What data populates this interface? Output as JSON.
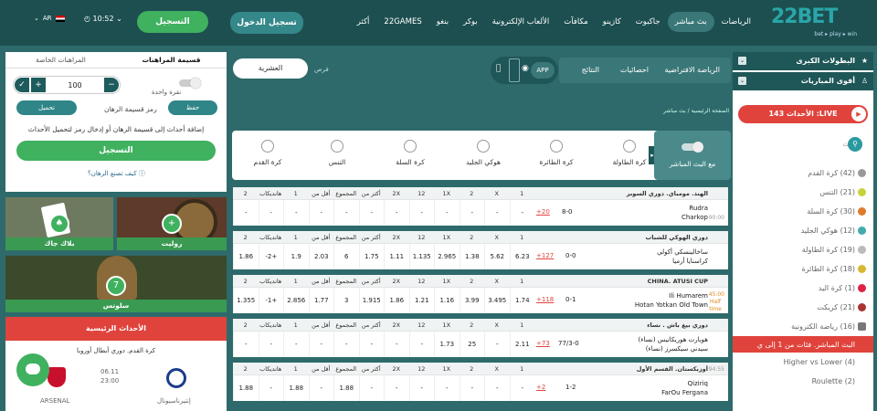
{
  "header": {
    "logo_main": "22BET",
    "logo_tag": "bet ▸ play ▸ win",
    "nav": [
      "الرياضات",
      "بث مباشر",
      "جاكبوت",
      "كازينو",
      "مكافآت",
      "الألعاب الإلكترونية",
      "بوكر",
      "بنغو",
      "22GAMES",
      "أكثر"
    ],
    "login": "تسجيل الدخول",
    "register": "التسجيل",
    "time": "10:52",
    "lang": "AR"
  },
  "top_tabs": {
    "virtual": "الرياضة الافتراضية",
    "stats": "احصائيات",
    "results": "النتائج",
    "app": "APP",
    "search_btn": "العشرية",
    "search_lbl": "فرص"
  },
  "breadcrumb": {
    "home": "الصفحة الرئيسية",
    "live": "بث مباشر"
  },
  "betslip": {
    "tab_slip": "قسيمة المراهنات",
    "tab_mybets": "المراهنات الخاصة",
    "stake": "100",
    "one_click": "نقرة واحدة",
    "save": "حفظ",
    "load": "تحميل",
    "code_label": "رمز قسيمة الرهان",
    "hint": "إضافة أحداث إلى قسيمة الرهان أو إدخال رمز لتحميل الأحداث",
    "register_btn": "التسجيل",
    "howto": "كيف تصنع الرهان؟"
  },
  "promos": {
    "blackjack": "بلاك جاك",
    "roulette": "روليت",
    "slots": "سلوتس"
  },
  "main_events": {
    "title": "الأحداث الرئيسية",
    "league": "كرة القدم. دوري أبطال أوروبا",
    "date": "06.11",
    "time": "23:00",
    "team1": "إنتيرناسيونال",
    "team2": "ARSENAL"
  },
  "sidebar": {
    "top_leagues": "البطولات الكبرى",
    "top_matches": "أقوى المباريات",
    "live_label": "الأحداث 143 :LIVE",
    "search": "البحث",
    "sports": [
      {
        "name": "كرة القدم",
        "count": "(42)",
        "color": "#888"
      },
      {
        "name": "التنس",
        "count": "(21)",
        "color": "#c8d23c"
      },
      {
        "name": "كرة السلة",
        "count": "(30)",
        "color": "#e07a2a"
      },
      {
        "name": "هوكي الجليد",
        "count": "(12)",
        "color": "#4aa"
      },
      {
        "name": "كرة الطاولة",
        "count": "(19)",
        "color": "#bbb"
      },
      {
        "name": "كرة الطائرة",
        "count": "(18)",
        "color": "#d8b830"
      },
      {
        "name": "كرة اليد",
        "count": "(1)",
        "color": "#d24"
      },
      {
        "name": "كريكت",
        "count": "(21)",
        "color": "#a33"
      },
      {
        "name": "رياضة الكترونية",
        "count": "(16)",
        "color": "#777"
      }
    ],
    "live_game": "البث المباشر. فئات من 1 إلى ي",
    "hl1": "Higher vs Lower (4)",
    "hl2": "Roulette (2)"
  },
  "categories": {
    "live_toggle": "مع البث المباشر",
    "items": [
      "كرة الطاولة",
      "كرة الطائرة",
      "هوكي الجليد",
      "كرة السلة",
      "التنس",
      "كرة القدم"
    ]
  },
  "odds_headers": [
    "1",
    "X",
    "2",
    "1X",
    "12",
    "2X",
    "أكثر من",
    "المجموع",
    "أقل من",
    "1",
    "هانديكاب",
    "2"
  ],
  "matches": [
    {
      "league": "الهند. مومباي. دوري السوبر",
      "t1": "Rudra",
      "t2": "Charkop",
      "score": "8-0",
      "more": "+20",
      "min": "90:00",
      "odds": [
        "-",
        "-",
        "-",
        "-",
        "-",
        "-",
        "-",
        "-",
        "-",
        "-",
        "-",
        "-"
      ]
    },
    {
      "league": "دوري الهوكي للشباب",
      "t1": "ساخالينسكي أكولي",
      "t2": "كراسنايا أرميا",
      "score": "0-0",
      "more": "+127",
      "min": "",
      "odds": [
        "6.23",
        "5.62",
        "1.38",
        "2.965",
        "1.135",
        "1.11",
        "1.75",
        "6",
        "2.03",
        "1.9",
        "+2-",
        "1.86"
      ]
    },
    {
      "league": "CHINA. ATUSI CUP",
      "t1": "Ili Humarem",
      "t2": "Hotan Yotkan Old Town",
      "score": "0-1",
      "more": "+118",
      "min": "45:00",
      "half": "Half time",
      "odds": [
        "1.74",
        "3.495",
        "3.99",
        "1.16",
        "1.21",
        "1.86",
        "1.915",
        "3",
        "1.77",
        "2.856",
        "+1-",
        "1.355"
      ]
    },
    {
      "league": "دوري بيغ باش . نساء",
      "t1": "هوبارت هوريكانيس (نساء)",
      "t2": "سيدني سيكسرز (نساء)",
      "score": "77/3-0",
      "more": "+73",
      "min": "",
      "odds": [
        "2.11",
        "-",
        "25",
        "1.73",
        "-",
        "-",
        "-",
        "-",
        "-",
        "-",
        "-",
        "-"
      ]
    },
    {
      "league": "أوزبكستان. القسم الأول",
      "t1": "Qiziriq",
      "t2": "FarOu Fergana",
      "score": "1-2",
      "more": "+2",
      "min": "94:55",
      "odds": [
        "-",
        "-",
        "-",
        "-",
        "-",
        "-",
        "-",
        "1.88",
        "-",
        "1.88",
        "-",
        "1.88"
      ]
    }
  ]
}
